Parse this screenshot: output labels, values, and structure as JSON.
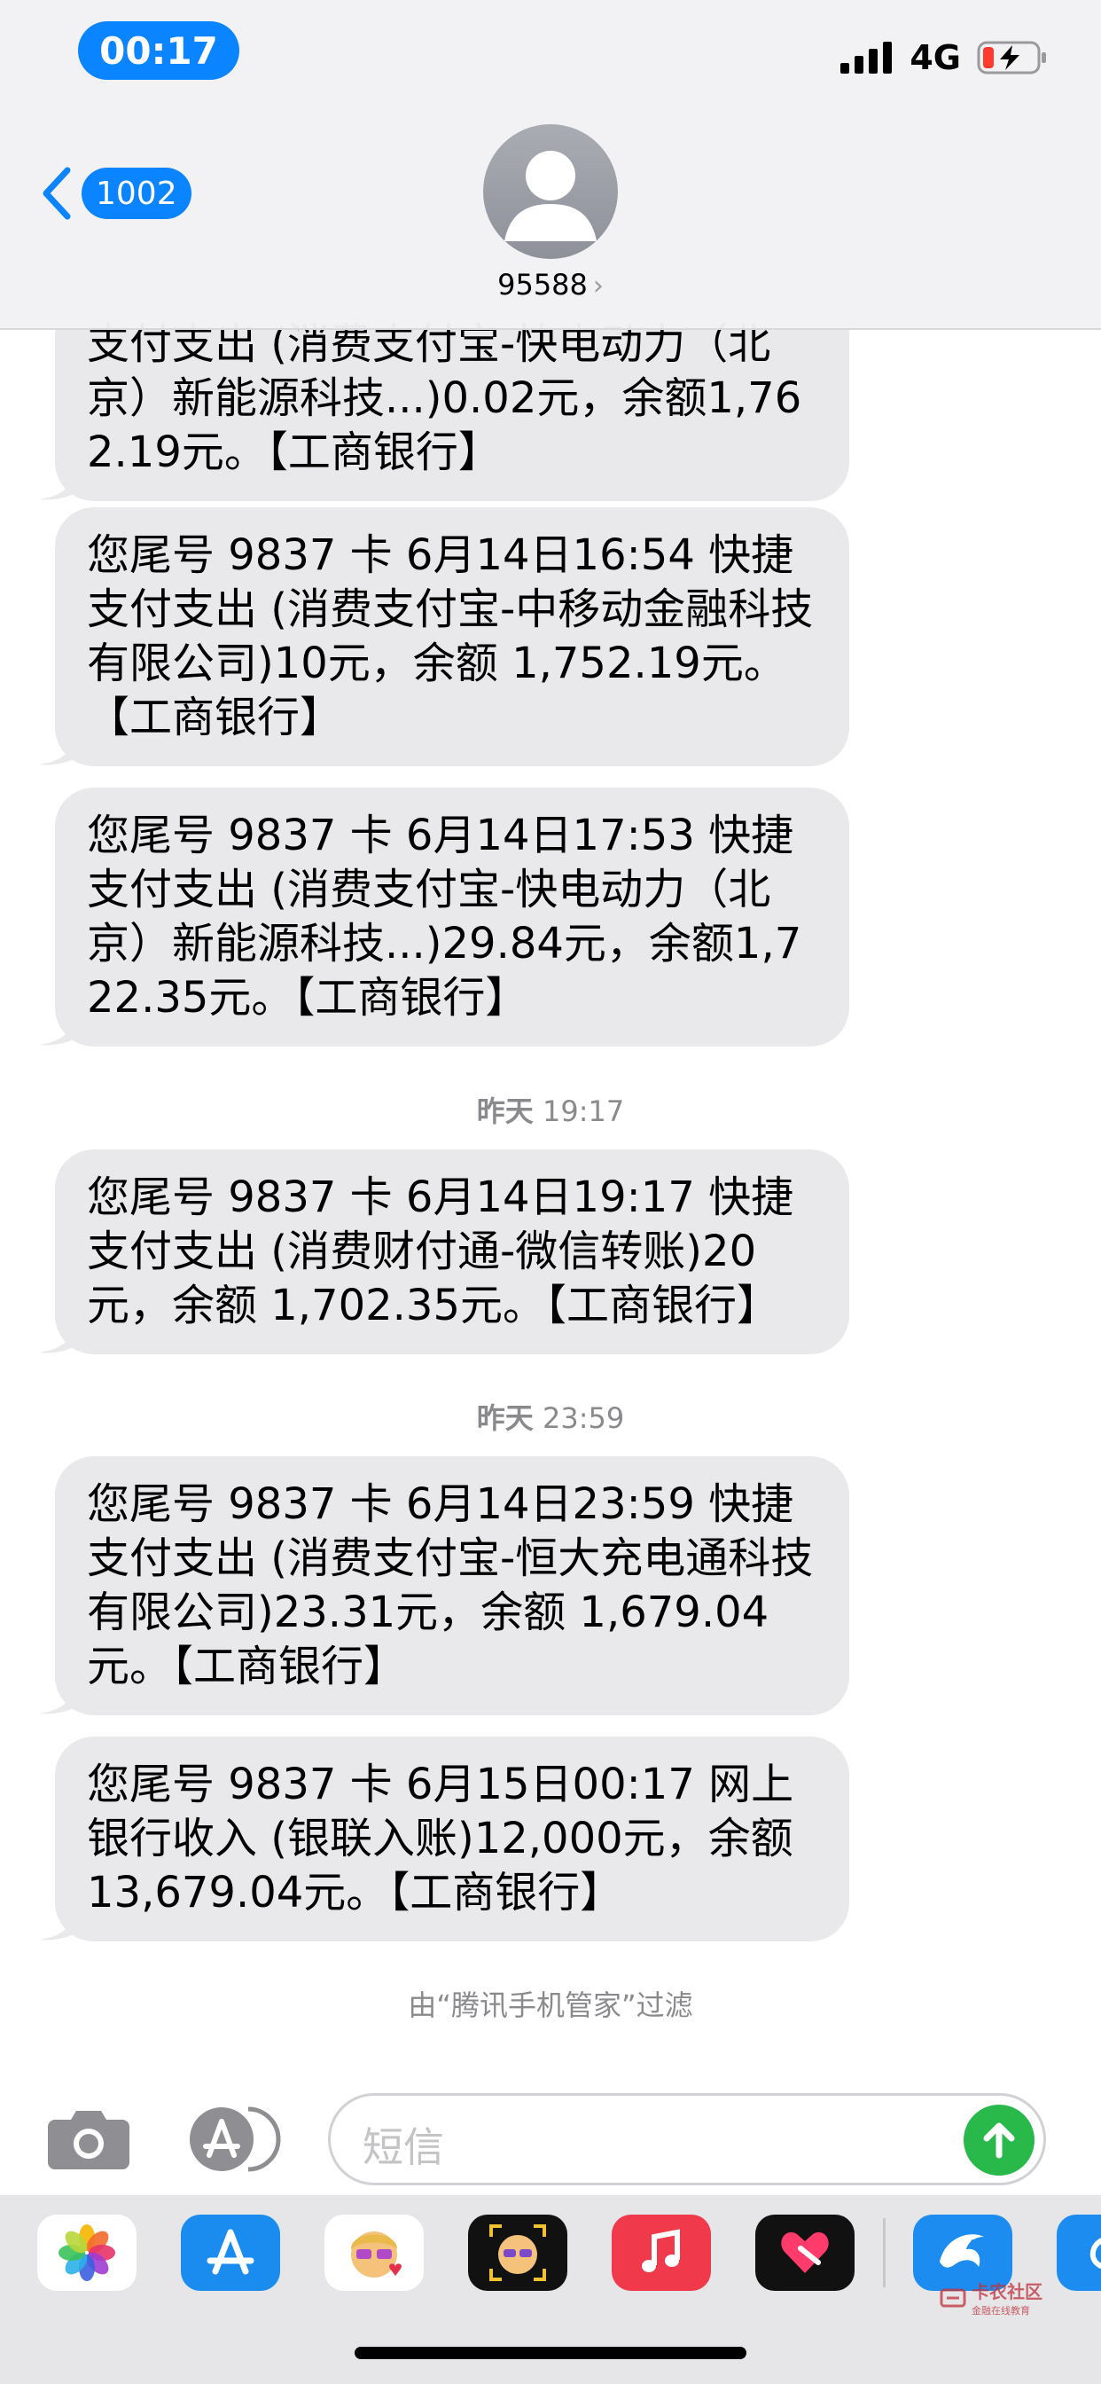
{
  "status_bar": {
    "time": "00:17",
    "network": "4G"
  },
  "header": {
    "back_badge": "1002",
    "contact": "95588",
    "contact_chevron": "›"
  },
  "messages": [
    {
      "type": "bubble",
      "text": "支付支出 (消费支付宝-快电动力（北京）新能源科技...)0.02元，余额1,762.19元。【工商银行】"
    },
    {
      "type": "bubble",
      "text": "您尾号 9837 卡 6月14日16:54 快捷支付支出 (消费支付宝-中移动金融科技有限公司)10元，余额 1,752.19元。【工商银行】"
    },
    {
      "type": "bubble",
      "text": "您尾号 9837 卡 6月14日17:53 快捷支付支出 (消费支付宝-快电动力（北京）新能源科技...)29.84元，余额1,722.35元。【工商银行】"
    },
    {
      "type": "timestamp",
      "day": "昨天",
      "time": "19:17"
    },
    {
      "type": "bubble",
      "text": "您尾号 9837 卡 6月14日19:17 快捷支付支出 (消费财付通-微信转账)20元，余额 1,702.35元。【工商银行】"
    },
    {
      "type": "timestamp",
      "day": "昨天",
      "time": "23:59"
    },
    {
      "type": "bubble",
      "text": "您尾号 9837 卡 6月14日23:59 快捷支付支出 (消费支付宝-恒大充电通科技有限公司)23.31元，余额 1,679.04元。【工商银行】"
    },
    {
      "type": "bubble",
      "text": "您尾号 9837 卡 6月15日00:17 网上银行收入 (银联入账)12,000元，余额13,679.04元。【工商银行】"
    }
  ],
  "filter_note": "由“腾讯手机管家”过滤",
  "input": {
    "placeholder": "短信"
  },
  "app_drawer": [
    {
      "name": "photos-app",
      "color": "#ffffff"
    },
    {
      "name": "app-store-app",
      "color": "#1a8cf0"
    },
    {
      "name": "memoji-stickers-app",
      "color": "#ffffff"
    },
    {
      "name": "memoji-camera-app",
      "color": "#111111"
    },
    {
      "name": "music-app",
      "color": "#f0394a"
    },
    {
      "name": "digital-touch-app",
      "color": "#111111"
    },
    {
      "name": "ctrip-app",
      "color": "#1c8cf0"
    }
  ],
  "watermark": {
    "line1": "卡农社区",
    "line2": "金融在线教育"
  }
}
